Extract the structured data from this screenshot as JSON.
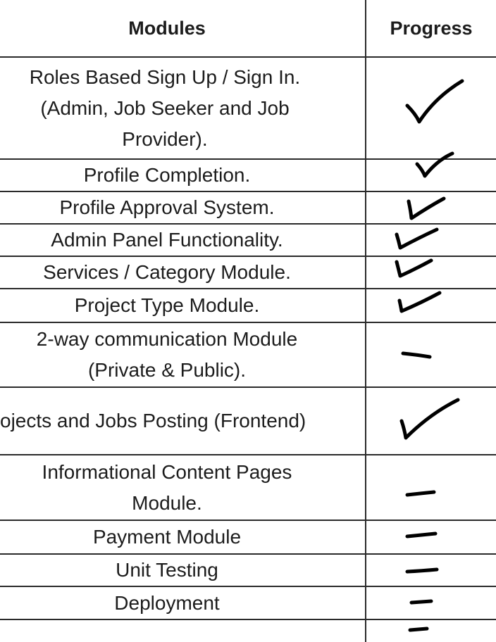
{
  "table": {
    "headers": {
      "modules": "Modules",
      "progress": "Progress"
    },
    "rows": [
      {
        "module": "Roles Based Sign Up / Sign In.\n(Admin, Job Seeker and Job\nProvider).",
        "progress": "done"
      },
      {
        "module": "Profile Completion.",
        "progress": "done"
      },
      {
        "module": "Profile Approval System.",
        "progress": "done"
      },
      {
        "module": "Admin Panel Functionality.",
        "progress": "done"
      },
      {
        "module": "Services / Category Module.",
        "progress": "done"
      },
      {
        "module": "Project Type Module.",
        "progress": "done"
      },
      {
        "module": "2-way communication Module\n(Private & Public).",
        "progress": "pending"
      },
      {
        "module": "ojects and Jobs Posting (Frontend)",
        "progress": "done"
      },
      {
        "module": "Informational Content Pages\nModule.",
        "progress": "pending"
      },
      {
        "module": "Payment Module",
        "progress": "pending"
      },
      {
        "module": "Unit Testing",
        "progress": "pending"
      },
      {
        "module": "Deployment",
        "progress": "pending"
      },
      {
        "module": "",
        "progress": "pending"
      }
    ]
  }
}
